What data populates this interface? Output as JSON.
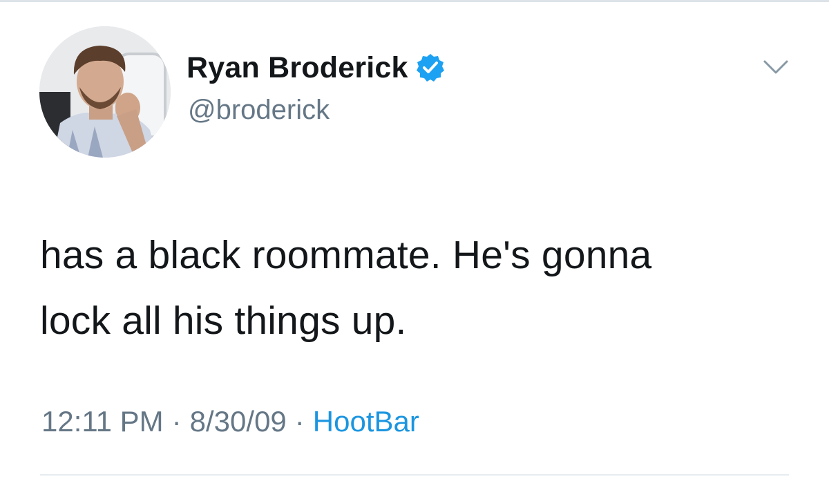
{
  "tweet": {
    "author": {
      "display_name": "Ryan Broderick",
      "handle": "@broderick",
      "verified": true,
      "avatar_icon": "profile-photo"
    },
    "text_lines": [
      "has a black roommate. He's gonna",
      "lock all his things up."
    ],
    "time": "12:11 PM",
    "date": "8/30/09",
    "separator": "·",
    "source": "HootBar",
    "menu_icon": "chevron-down-icon"
  },
  "colors": {
    "text": "#14171a",
    "secondary": "#657786",
    "link": "#1b95e0",
    "verified_badge": "#1da1f2",
    "divider": "#e6ecf0"
  }
}
